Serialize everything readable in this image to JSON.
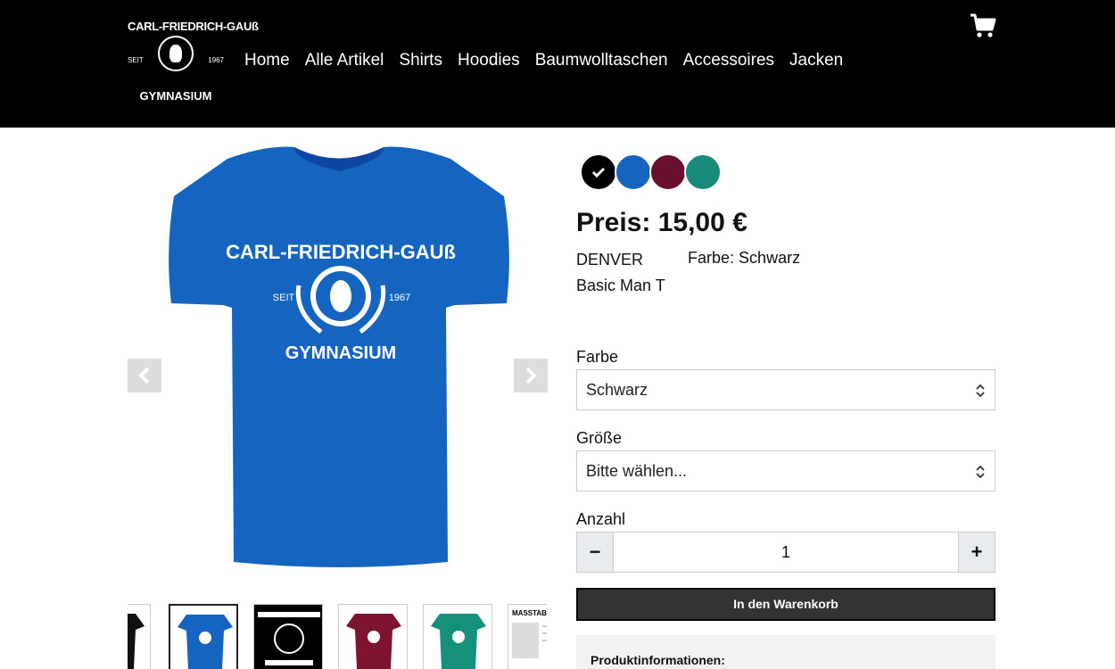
{
  "header": {
    "logo": {
      "top": "CARL-FRIEDRICH-GAUß",
      "left": "SEIT",
      "right": "1967",
      "bottom": "GYMNASIUM"
    },
    "nav": [
      "Home",
      "Alle Artikel",
      "Shirts",
      "Hoodies",
      "Baumwolltaschen",
      "Accessoires",
      "Jacken"
    ],
    "cart_icon": "shopping-cart-icon"
  },
  "gallery": {
    "shirt_color": "#1565c0",
    "print": {
      "top": "CARL-FRIEDRICH-GAUß",
      "left": "SEIT",
      "right": "1967",
      "bottom": "GYMNASIUM"
    },
    "thumbs": [
      {
        "kind": "shirt",
        "color": "#111111"
      },
      {
        "kind": "shirt",
        "color": "#1565c0"
      },
      {
        "kind": "logo",
        "color": "#000000"
      },
      {
        "kind": "shirt",
        "color": "#7d1530"
      },
      {
        "kind": "shirt",
        "color": "#15917b"
      },
      {
        "kind": "size-chart",
        "title": "MASSTAB"
      }
    ]
  },
  "product": {
    "swatches": [
      {
        "color": "#000000",
        "selected": true
      },
      {
        "color": "#1565c0",
        "selected": false
      },
      {
        "color": "#6b0f30",
        "selected": false
      },
      {
        "color": "#1a8a7d",
        "selected": false
      }
    ],
    "price": "Preis: 15,00 €",
    "name": "DENVER Basic Man T",
    "color_label": "Farbe:",
    "color_value": "Schwarz",
    "farbe_label": "Farbe",
    "farbe_value": "Schwarz",
    "groesse_label": "Größe",
    "groesse_value": "Bitte wählen...",
    "anzahl_label": "Anzahl",
    "qty_minus": "−",
    "qty_value": "1",
    "qty_plus": "+",
    "add_to_cart": "In den Warenkorb",
    "info_title": "Produktinformationen:"
  }
}
